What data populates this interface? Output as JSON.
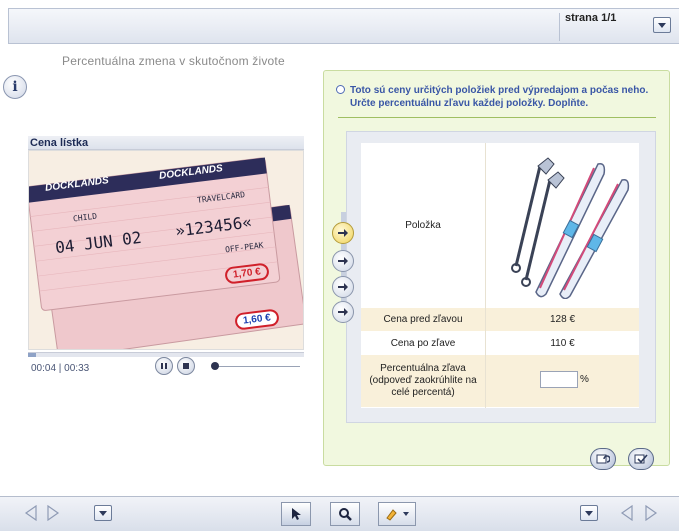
{
  "header": {
    "page_label": "strana 1/1",
    "dropdown_icon": "chevron-down-icon"
  },
  "lesson": {
    "title": "Percentuálna zmena v skutočnom živote",
    "info_icon_glyph": "i"
  },
  "media": {
    "title": "Cena lístka",
    "time": "00:04 | 00:33",
    "progress_fraction": 0.03,
    "ticket": {
      "brand": "DOCKLANDS",
      "type": "TRAVELCARD",
      "date": "04 JUN 02",
      "number": "»123456«",
      "class": "CHILD",
      "offpeak": "OFF-PEAK",
      "price1": "1,70 €",
      "price2": "1,60 €"
    }
  },
  "exercise": {
    "instruction": "Toto sú ceny určitých položiek pred výpredajom a počas neho. Určte percentuálnu zľavu každej položky. Doplňte.",
    "item_label": "Položka",
    "price_before_label": "Cena pred zľavou",
    "price_before_value": "128 €",
    "price_after_label": "Cena po zľave",
    "price_after_value": "110 €",
    "discount_label": "Percentuálna zľava (odpoveď zaokrúhlite na celé percentá)",
    "discount_value": "",
    "discount_unit": "%"
  },
  "colors": {
    "accent_blue": "#3956a6",
    "panel_green": "#f1f8df",
    "row_tan": "#f9f0da",
    "price_red": "#d0202a",
    "price_blue": "#1b3fb0"
  }
}
